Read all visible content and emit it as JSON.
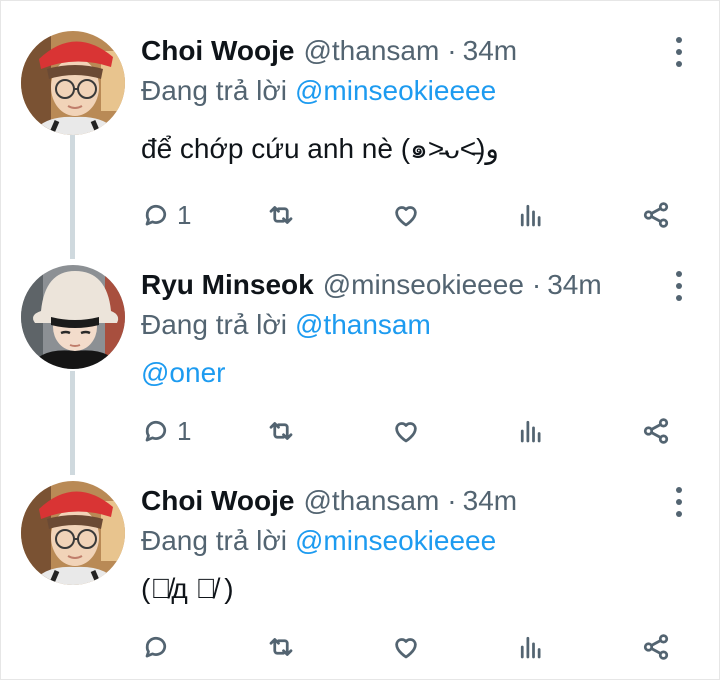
{
  "tweets": [
    {
      "name": "Choi Wooje",
      "handle": "@thansam",
      "separator": "·",
      "time": "34m",
      "replying_prefix": "Đang trả lời",
      "replying_to": "@minseokieeee",
      "text": "để chớp cứu anh nè (๑˃̵ᴗ˂̵)و",
      "reply_count": "1"
    },
    {
      "name": "Ryu Minseok",
      "handle": "@minseokieeee",
      "separator": "·",
      "time": "34m",
      "replying_prefix": "Đang trả lời",
      "replying_to": "@thansam",
      "text": "@oner",
      "reply_count": "1"
    },
    {
      "name": "Choi Wooje",
      "handle": "@thansam",
      "separator": "·",
      "time": "34m",
      "replying_prefix": "Đang trả lời",
      "replying_to": "@minseokieeee",
      "text": "(ｦ̸д ｦ̸ )",
      "reply_count": ""
    }
  ],
  "icons": [
    "reply-icon",
    "retweet-icon",
    "like-icon",
    "analytics-icon",
    "share-icon",
    "more-options-icon"
  ],
  "colors": {
    "link": "#1d9bf0",
    "muted": "#536471",
    "text": "#0f1419",
    "thread_line": "#cfd9de"
  }
}
